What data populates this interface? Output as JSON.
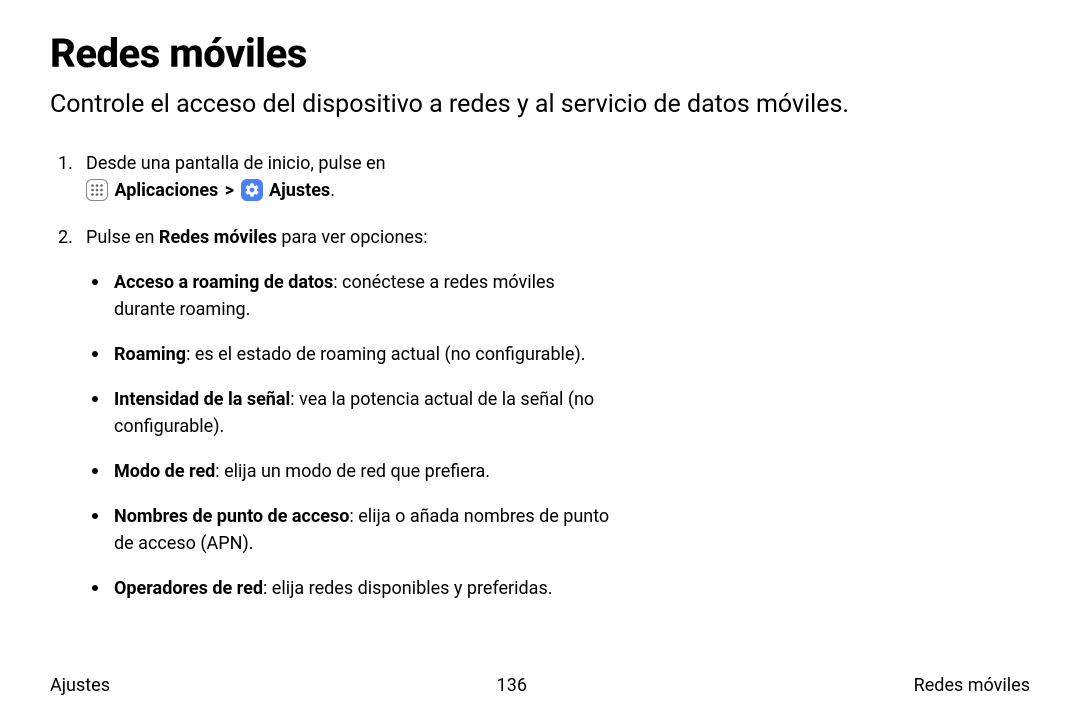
{
  "title": "Redes móviles",
  "subtitle": "Controle el acceso del dispositivo a redes y al servicio de datos móviles.",
  "step1": {
    "prefix": "Desde una pantalla de inicio, pulse en",
    "app_label": "Aplicaciones",
    "chev": ">",
    "settings_label": "Ajustes",
    "period": "."
  },
  "step2": {
    "prefix": "Pulse en ",
    "bold": "Redes móviles",
    "suffix": " para ver opciones:"
  },
  "bullets": [
    {
      "bold": "Acceso a roaming de datos",
      "text": ": conéctese a redes móviles durante roaming."
    },
    {
      "bold": "Roaming",
      "text": ": es el estado de roaming actual (no configurable)."
    },
    {
      "bold": "Intensidad de la señal",
      "text": ": vea la potencia actual de la señal (no configurable)."
    },
    {
      "bold": "Modo de red",
      "text": ": elija un modo de red que prefiera."
    },
    {
      "bold": "Nombres de punto de acceso",
      "text": ": elija o añada nombres de punto de acceso (APN)."
    },
    {
      "bold": "Operadores de red",
      "text": ": elija redes disponibles y preferidas."
    }
  ],
  "footer": {
    "left": "Ajustes",
    "center": "136",
    "right": "Redes móviles"
  }
}
